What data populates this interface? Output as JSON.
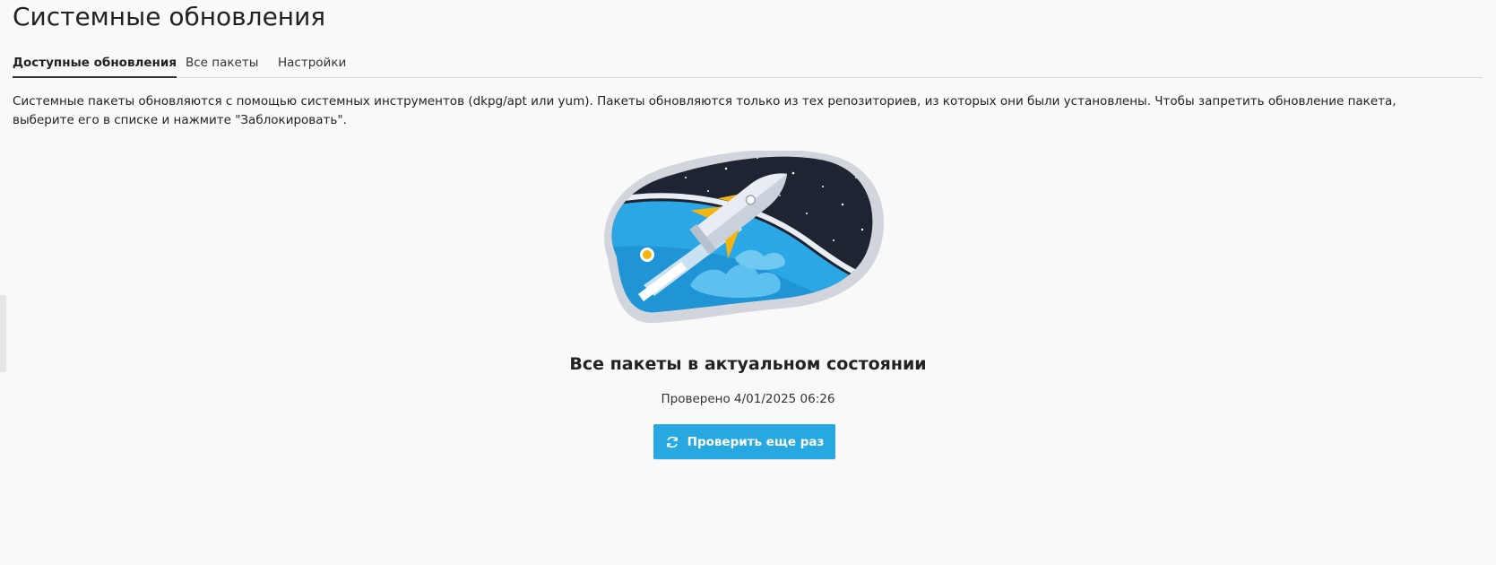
{
  "page": {
    "title": "Системные обновления"
  },
  "tabs": [
    {
      "label": "Доступные обновления",
      "active": true
    },
    {
      "label": "Все пакеты",
      "active": false
    },
    {
      "label": "Настройки",
      "active": false
    }
  ],
  "description": "Системные пакеты обновляются с помощью системных инструментов (dkpg/apt или yum). Пакеты обновляются только из тех репозиториев, из которых они были установлены. Чтобы запретить обновление пакета, выберите его в списке и нажмите \"Заблокировать\".",
  "status": {
    "title": "Все пакеты в актуальном состоянии",
    "checked_text": "Проверено 4/01/2025 06:26"
  },
  "actions": {
    "recheck_label": "Проверить еще раз",
    "recheck_icon": "refresh-icon"
  },
  "colors": {
    "accent": "#28a8e0",
    "background": "#f9f9f9",
    "space": "#1f2433",
    "earth": "#2aa7e4"
  }
}
